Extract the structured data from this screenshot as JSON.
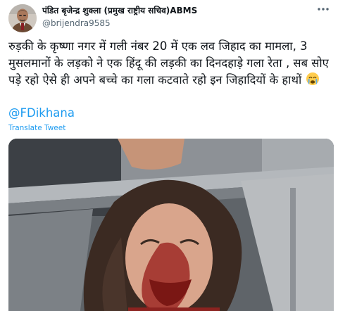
{
  "tweet": {
    "author": {
      "display_name": "पंडित बृजेन्द्र शुक्ला (प्रमुख राष्ट्रीय सचिव)ABMS",
      "handle": "@brijendra9585"
    },
    "more_icon": "more-horizontal-icon",
    "text": "रुड़की के कृष्णा नगर में गली नंबर 20 में एक लव जिहाद का मामला, 3 मुसलमानों के लड़को ने एक हिंदू की लड़की का दिनदहाड़े गला रेता , सब सोए पड़े रहो ऐसे ही अपने बच्चे का गला कटवाते रहो इन जिहादियों के हाथों",
    "emoji": "crying-face-emoji",
    "mention": "@FDikhana",
    "translate_label": "Translate Tweet",
    "media_icon": "photo"
  },
  "colors": {
    "link": "#1d9bf0",
    "text": "#0f1419",
    "secondary": "#536471"
  }
}
